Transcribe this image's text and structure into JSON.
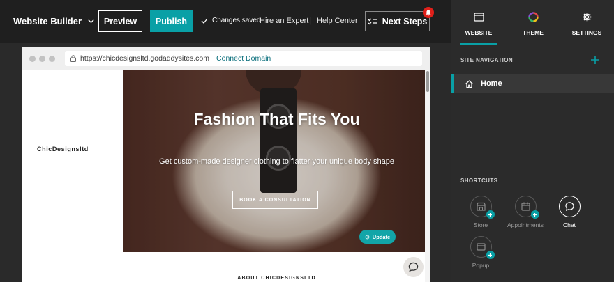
{
  "topbar": {
    "brand": "Website Builder",
    "preview_label": "Preview",
    "publish_label": "Publish",
    "saved_status": "Changes saved",
    "hire_expert": "Hire an Expert",
    "separator": "|",
    "help_center": "Help Center",
    "next_steps": "Next Steps"
  },
  "browser": {
    "url": "https://chicdesignsltd.godaddysites.com",
    "connect_domain": "Connect Domain"
  },
  "site": {
    "logo": "ChicDesignsltd",
    "hero_title": "Fashion That Fits You",
    "hero_subtitle": "Get custom-made designer clothing to flatter your unique body shape",
    "cta": "BOOK A CONSULTATION",
    "update_label": "Update",
    "about_title": "ABOUT CHICDESIGNSLTD"
  },
  "panel": {
    "tabs": [
      {
        "label": "WEBSITE",
        "icon": "browser-window-icon",
        "active": true
      },
      {
        "label": "THEME",
        "icon": "color-wheel-icon",
        "active": false
      },
      {
        "label": "SETTINGS",
        "icon": "gear-icon",
        "active": false
      }
    ],
    "site_navigation_label": "SITE NAVIGATION",
    "nav_items": [
      {
        "label": "Home",
        "icon": "home-icon"
      }
    ],
    "shortcuts_label": "SHORTCUTS",
    "shortcuts": [
      {
        "label": "Store",
        "icon": "store-icon"
      },
      {
        "label": "Appointments",
        "icon": "calendar-icon"
      },
      {
        "label": "Chat",
        "icon": "chat-icon"
      },
      {
        "label": "Popup",
        "icon": "popup-icon"
      }
    ]
  },
  "colors": {
    "accent": "#09a0a6",
    "background": "#1f1f1f",
    "panel": "#2b2b2b",
    "notification": "#e0201a"
  }
}
